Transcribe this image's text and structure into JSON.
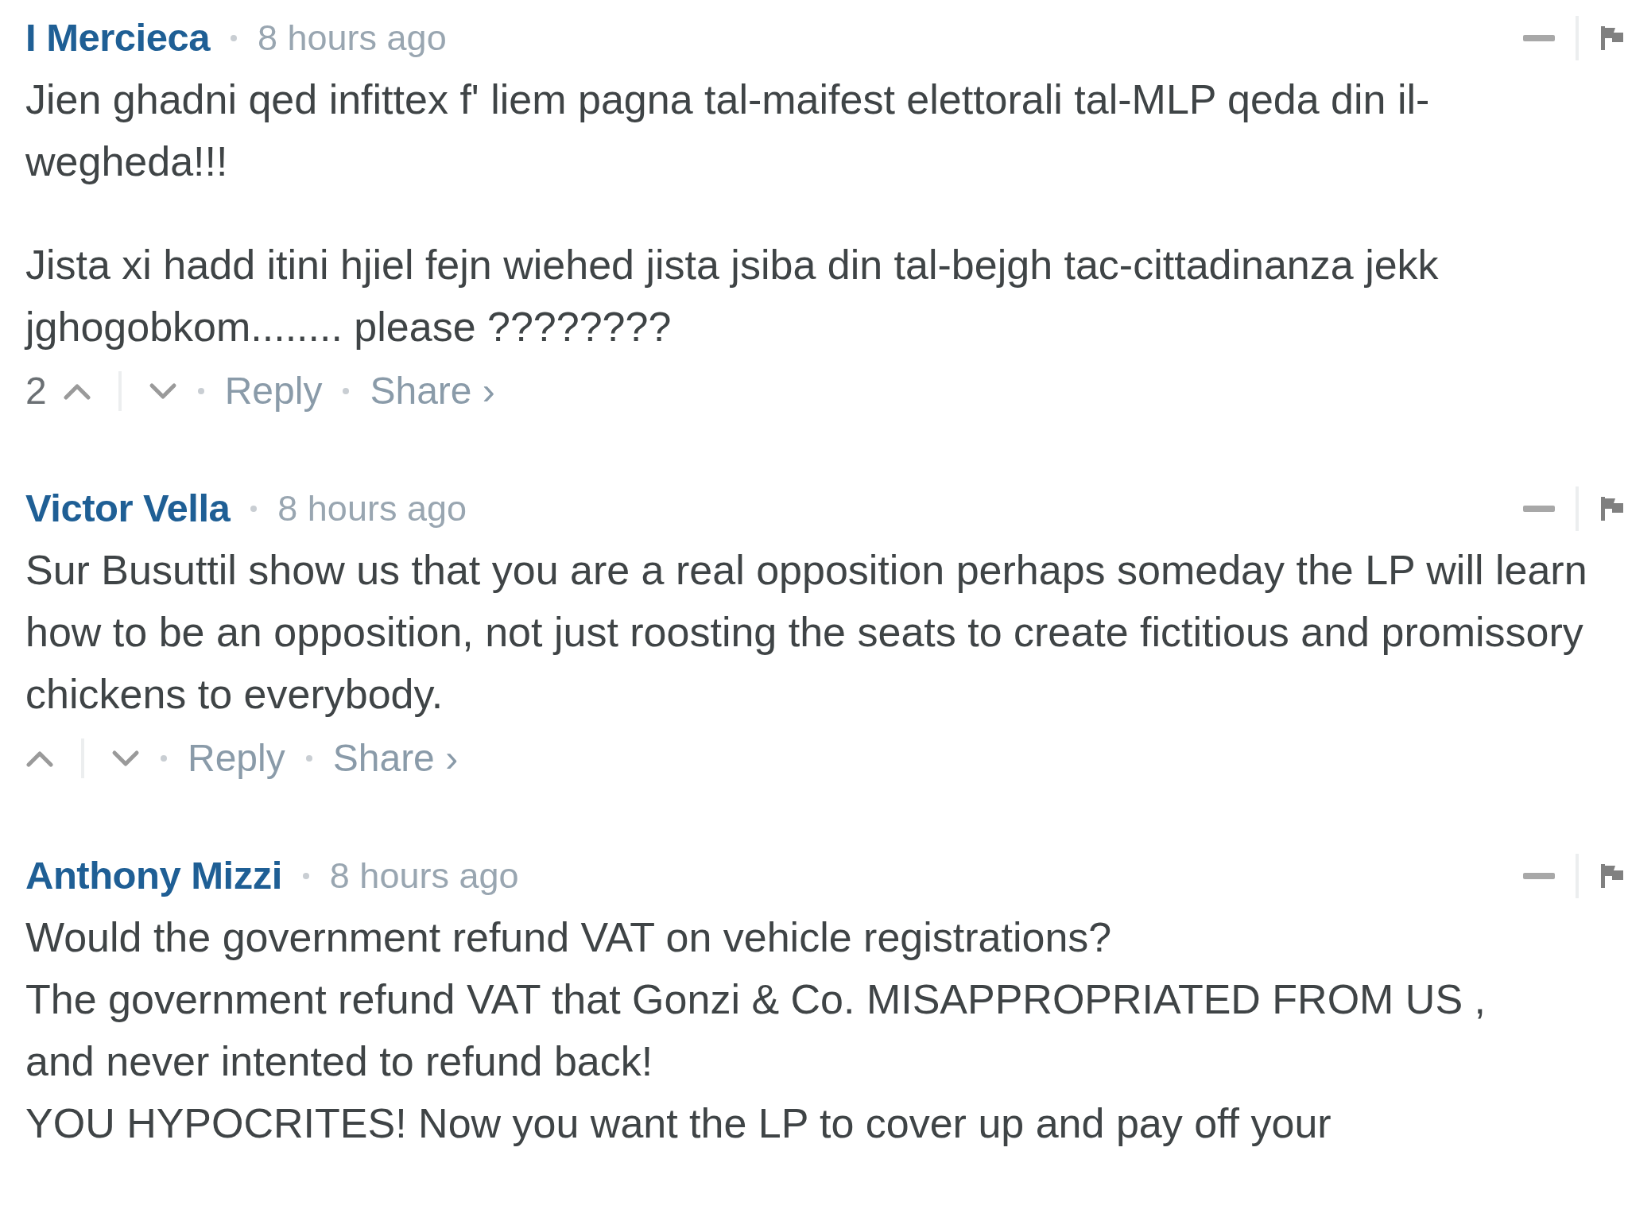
{
  "comments": [
    {
      "author": "I Mercieca",
      "time": "8 hours ago",
      "paragraphs": [
        "Jien ghadni qed infittex f' liem pagna tal-maifest elettorali tal-MLP qeda din il-wegheda!!!",
        "Jista xi hadd itini hjiel fejn wiehed jista jsiba din tal-bejgh tac-cittadinanza jekk jghogobkom........ please ????????"
      ],
      "votes": "2",
      "actions": [
        "Reply",
        "Share ›"
      ]
    },
    {
      "author": "Victor Vella",
      "time": "8 hours ago",
      "paragraphs": [
        "Sur Busuttil show us that you are a real opposition perhaps someday the LP will learn how to be an opposition, not just roosting the seats to create fictitious and promissory\nchickens to everybody."
      ],
      "actions": [
        "Reply",
        "Share ›"
      ]
    },
    {
      "author": "Anthony Mizzi",
      "time": "8 hours ago",
      "paragraphs": [
        "Would the government refund VAT on vehicle registrations?\nThe government refund VAT that Gonzi & Co. MISAPPROPRIATED FROM US ,\nand never intented to refund back!\nYOU HYPOCRITES! Now you want the LP to cover up and pay off your"
      ]
    }
  ]
}
